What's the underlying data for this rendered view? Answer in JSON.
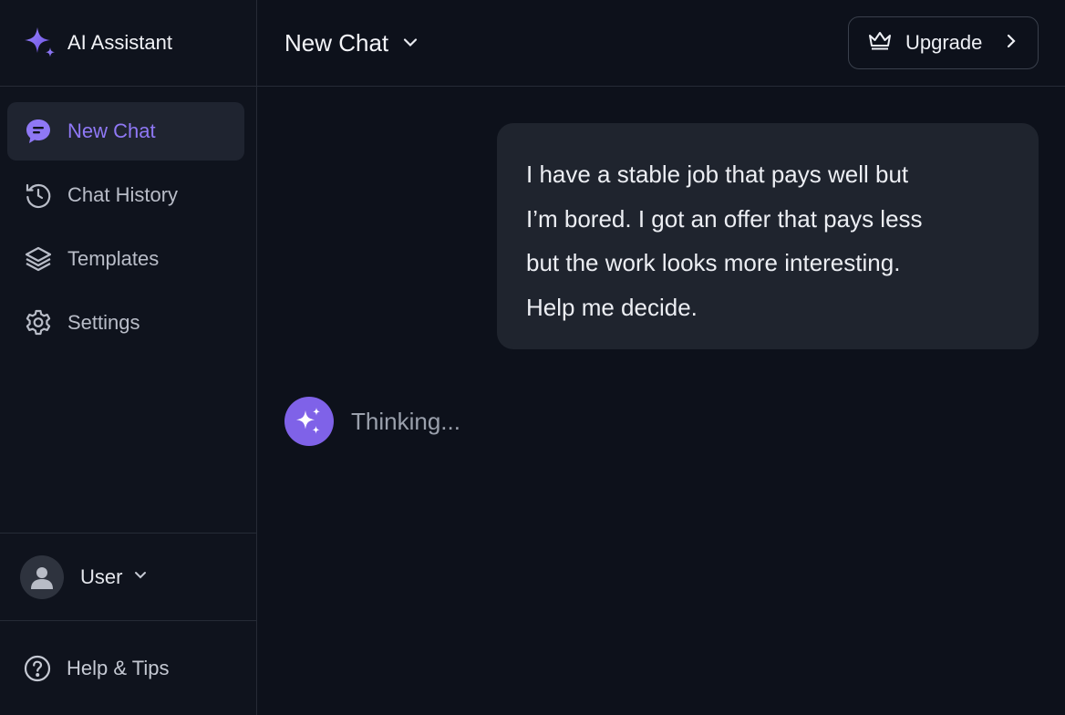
{
  "app": {
    "name": "AI Assistant"
  },
  "sidebar": {
    "items": [
      {
        "label": "New Chat",
        "icon": "chat-bubble-icon",
        "active": true
      },
      {
        "label": "Chat History",
        "icon": "history-icon",
        "active": false
      },
      {
        "label": "Templates",
        "icon": "layers-icon",
        "active": false
      },
      {
        "label": "Settings",
        "icon": "gear-icon",
        "active": false
      }
    ],
    "user": {
      "name": "User"
    },
    "help": {
      "label": "Help & Tips"
    }
  },
  "header": {
    "title": "New Chat",
    "upgrade_label": "Upgrade"
  },
  "conversation": {
    "user_message_lines": [
      "I have a stable job that pays well but",
      "I’m bored. I got an offer that pays less",
      "but the work looks more interesting.",
      "Help me decide."
    ],
    "assistant_status": "Thinking..."
  },
  "colors": {
    "accent": "#8f78f5",
    "assistant_avatar": "#7f62e8",
    "background": "#0d111b",
    "sidebar": "#0f131d",
    "bubble": "#1f242e"
  }
}
